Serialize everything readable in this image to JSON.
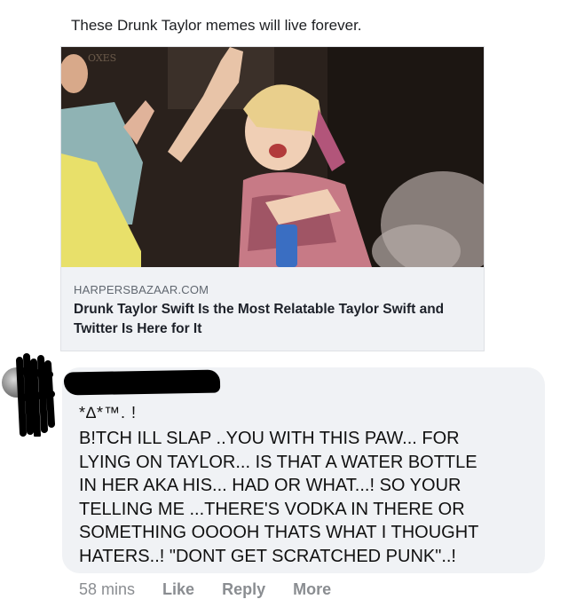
{
  "post": {
    "caption": "These Drunk Taylor memes will live forever."
  },
  "link_preview": {
    "domain": "HARPERSBAZAAR.COM",
    "title": "Drunk Taylor Swift Is the Most Relatable Taylor Swift and Twitter Is Here for It",
    "image_sign_text": "OXES"
  },
  "comment": {
    "symbols": "*∆*™. !",
    "text": "B!TCH ILL SLAP ..YOU WITH THIS PAW... FOR\nLYING ON TAYLOR... IS THAT A WATER BOTTLE\nIN HER AKA HIS... HAD OR WHAT...! SO YOUR\nTELLING ME ...THERE'S VODKA IN THERE OR\nSOMETHING OOOOH THATS WHAT I THOUGHT\nHATERS..! \"DONT GET SCRATCHED PUNK\"..!",
    "time": "58 mins",
    "like_label": "Like",
    "reply_label": "Reply",
    "more_label": "More"
  }
}
